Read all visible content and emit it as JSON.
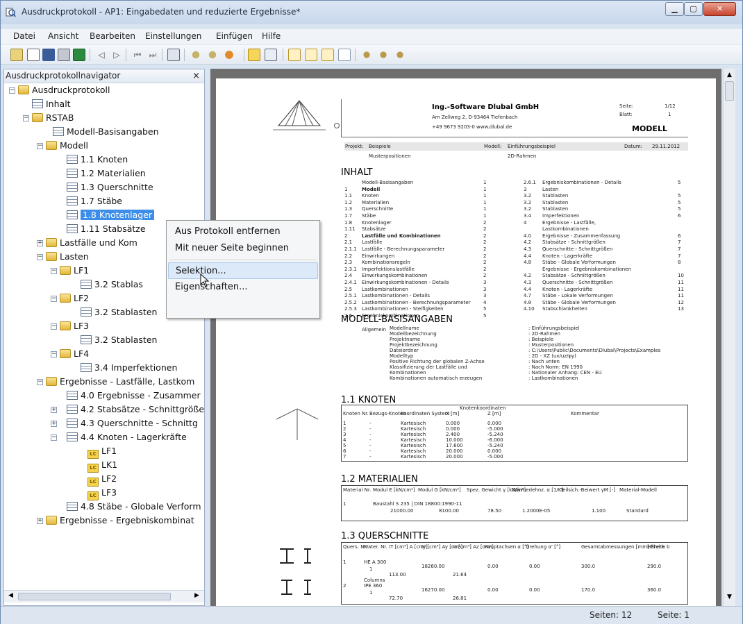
{
  "window": {
    "title": "Ausdruckprotokoll - AP1: Eingabedaten und reduzierte Ergebnisse*"
  },
  "menu": [
    "Datei",
    "Ansicht",
    "Bearbeiten",
    "Einstellungen",
    "Einfügen",
    "Hilfe"
  ],
  "navigator": {
    "title": "Ausdruckprotokollnavigator",
    "close": "×",
    "items": {
      "root": "Ausdruckprotokoll",
      "inhalt": "Inhalt",
      "rstab": "RSTAB",
      "modell_basis": "Modell-Basisangaben",
      "modell": "Modell",
      "knoten": "1.1 Knoten",
      "materialien": "1.2 Materialien",
      "querschnitte": "1.3 Querschnitte",
      "staebe": "1.7 Stäbe",
      "knotenlager": "1.8 Knotenlager",
      "stabsaetze": "1.11 Stabsätze",
      "lastfaelle": "Lastfälle und Kom",
      "lasten": "Lasten",
      "lf1": "LF1",
      "lf1_stablasten": "3.2 Stablas",
      "lf2": "LF2",
      "lf2_stablasten": "3.2 Stablasten",
      "lf3": "LF3",
      "lf3_stablasten": "3.2 Stablasten",
      "lf4": "LF4",
      "lf4_imperfektionen": "3.4 Imperfektionen",
      "ergebnisse": "Ergebnisse - Lastfälle, Lastkom",
      "erg_zusammen": "4.0 Ergebnisse - Zusammer",
      "stabsaetze_schnitt": "4.2 Stabsätze - Schnittgröße",
      "querschnitte_schnitt": "4.3 Querschnitte - Schnittg",
      "knoten_lager": "4.4 Knoten - Lagerkräfte",
      "lc_lf1": "LF1",
      "lc_lk1": "LK1",
      "lc_lf2": "LF2",
      "lc_lf3": "LF3",
      "staebe_verform": "4.8 Stäbe - Globale Verform",
      "erg_kombinat": "Ergebnisse - Ergebniskombinat"
    },
    "lc_badge": "LC"
  },
  "context_menu": [
    "Aus Protokoll entfernen",
    "Mit neuer Seite beginnen",
    "Selektion...",
    "Eigenschaften..."
  ],
  "status": {
    "pages": "Seiten: 12",
    "page": "Seite: 1"
  },
  "doc": {
    "company": "Ing.-Software Dlubal GmbH",
    "address": "Am Zellweg 2, D-93464 Tiefenbach",
    "phone": "+49 9673 9203-0  www.dlubal.de",
    "seite_label": "Seite:",
    "seite": "1/12",
    "blatt_label": "Blatt:",
    "blatt": "1",
    "section": "MODELL",
    "projekt_label": "Projekt:",
    "projekt": "Beispiele",
    "projekt2": "Musterpositionen",
    "modell_label": "Modell:",
    "modell": "Einführungsbeispiel",
    "modell2": "2D-Rahmen",
    "datum_label": "Datum:",
    "datum": "29.11.2012",
    "h_inhalt": "INHALT",
    "toc": [
      [
        "",
        "Modell-Basisangaben",
        "1",
        "2.6.1",
        "Ergebniskombinationen - Details",
        "5"
      ],
      [
        "1",
        "Modell",
        "1",
        "3",
        "Lasten",
        ""
      ],
      [
        "1.1",
        "Knoten",
        "1",
        "3.2",
        "Stablasten",
        "5"
      ],
      [
        "1.2",
        "Materialien",
        "1",
        "3.2",
        "Stablasten",
        "5"
      ],
      [
        "1.3",
        "Querschnitte",
        "1",
        "3.2",
        "Stablasten",
        "5"
      ],
      [
        "1.7",
        "Stäbe",
        "1",
        "3.4",
        "Imperfektionen",
        "6"
      ],
      [
        "1.8",
        "Knotenlager",
        "2",
        "4",
        "Ergebnisse - Lastfälle,",
        ""
      ],
      [
        "1.11",
        "Stabsätze",
        "2",
        "",
        "Lastkombinationen",
        ""
      ],
      [
        "2",
        "Lastfälle und Kombinationen",
        "2",
        "4.0",
        "Ergebnisse - Zusammenfassung",
        "6"
      ],
      [
        "2.1",
        "Lastfälle",
        "2",
        "4.2",
        "Stabsätze - Schnittgrößen",
        "7"
      ],
      [
        "2.1.1",
        "Lastfälle - Berechnungsparameter",
        "2",
        "4.3",
        "Querschnitte - Schnittgrößen",
        "7"
      ],
      [
        "2.2",
        "Einwirkungen",
        "2",
        "4.4",
        "Knoten - Lagerkräfte",
        "7"
      ],
      [
        "2.3",
        "Kombinationsregeln",
        "2",
        "4.8",
        "Stäbe - Globale Verformungen",
        "8"
      ],
      [
        "2.3.1",
        "Imperfektionslastfälle",
        "2",
        "",
        "Ergebnisse - Ergebniskombinationen",
        ""
      ],
      [
        "2.4",
        "Einwirkungskombinationen",
        "2",
        "4.2",
        "Stabsätze - Schnittgrößen",
        "10"
      ],
      [
        "2.4.1",
        "Einwirkungskombinationen - Details",
        "3",
        "4.3",
        "Querschnitte - Schnittgrößen",
        "11"
      ],
      [
        "2.5",
        "Lastkombinationen",
        "3",
        "4.4",
        "Knoten - Lagerkräfte",
        "11"
      ],
      [
        "2.5.1",
        "Lastkombinationen - Details",
        "3",
        "4.7",
        "Stäbe - Lokale Verformungen",
        "11"
      ],
      [
        "2.5.2",
        "Lastkombinationen - Berechnungsparameter",
        "4",
        "4.8",
        "Stäbe - Globale Verformungen",
        "12"
      ],
      [
        "2.5.3",
        "Lastkombinationen - Steifigkeiten",
        "5",
        "4.10",
        "Stabschlankheiten",
        "13"
      ],
      [
        "2.6",
        "Ergebniskombinationen",
        "5",
        "",
        "",
        ""
      ]
    ],
    "h_basis": "MODELL-BASISANGABEN",
    "basis_group": "Allgemein",
    "basis": [
      [
        "Modellname",
        "Einführungsbeispiel"
      ],
      [
        "Modellbezeichnung",
        "2D-Rahmen"
      ],
      [
        "Projektname",
        "Beispiele"
      ],
      [
        "Projektbezeichnung",
        "Musterpositionen"
      ],
      [
        "Dateiordner",
        "C:\\Users\\Public\\Documents\\Dlubal\\Projects\\Examples"
      ],
      [
        "Modelltyp",
        "2D - XZ (ux/uz/φy)"
      ],
      [
        "Positive Richtung der globalen Z-Achse",
        "Nach unten"
      ],
      [
        "Klassifizierung der Lastfälle und",
        "Nach Norm: EN 1990"
      ],
      [
        "Kombinationen",
        "Nationaler Anhang: CEN - EU"
      ],
      [
        "Kombinationen automatisch erzeugen",
        "Lastkombinationen"
      ]
    ],
    "h_knoten": "1.1 KNOTEN",
    "knoten_head": [
      "Knoten Nr.",
      "Bezugs-Knoten",
      "Koordinaten System",
      "X [m]",
      "Z [m]",
      "Kommentar"
    ],
    "knoten_head_group": "Knotenkoordinaten",
    "knoten": [
      [
        "1",
        "-",
        "Kartesisch",
        "0.000",
        "0.000"
      ],
      [
        "2",
        "-",
        "Kartesisch",
        "0.000",
        "-5.000"
      ],
      [
        "3",
        "-",
        "Kartesisch",
        "2.400",
        "-5.240"
      ],
      [
        "4",
        "-",
        "Kartesisch",
        "10.000",
        "-6.000"
      ],
      [
        "5",
        "-",
        "Kartesisch",
        "17.600",
        "-5.240"
      ],
      [
        "6",
        "-",
        "Kartesisch",
        "20.000",
        "0.000"
      ],
      [
        "7",
        "-",
        "Kartesisch",
        "20.000",
        "-5.000"
      ]
    ],
    "h_mat": "1.2 MATERIALIEN",
    "mat_head": [
      "Material Nr.",
      "Modul E [kN/cm²]",
      "Modul G [kN/cm²]",
      "Spez. Gewicht γ [kN/m³]",
      "Wärmedehnz. α [1/K]",
      "Teilsich.-Beiwert γM [-]",
      "Material-Modell"
    ],
    "mat_row": [
      "1",
      "Baustahl S 235 | DIN 18800:1990-11",
      "21000.00",
      "8100.00",
      "78.50",
      "1.2000E-05",
      "1.100",
      "Standard"
    ],
    "h_qs": "1.3 QUERSCHNITTE",
    "qs_head": [
      "Quers. Nr.",
      "Mater. Nr.",
      "IT [cm⁴] A [cm²]",
      "Iy [cm⁴] Ay [cm²]",
      "Iz [cm⁴] Az [cm²]",
      "Hauptachsen α [°]",
      "Drehung α' [°]",
      "Gesamtabmessungen [mm] Breite b",
      "Höhe h"
    ],
    "qs": [
      [
        "1",
        "HE A 300",
        "1",
        "113.00",
        "18260.00",
        "21.64",
        "0.00",
        "0.00",
        "300.0",
        "290.0",
        "Columns"
      ],
      [
        "2",
        "IPE 360",
        "1",
        "72.70",
        "16270.00",
        "26.81",
        "0.00",
        "0.00",
        "170.0",
        "360.0",
        ""
      ]
    ]
  }
}
